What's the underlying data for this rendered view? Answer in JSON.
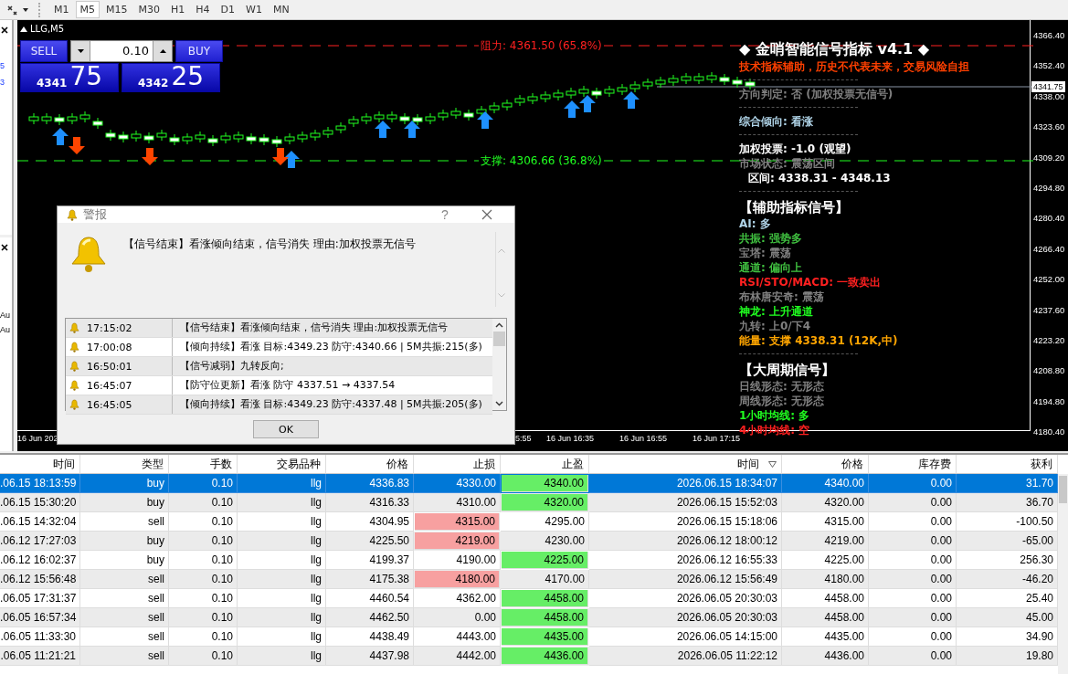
{
  "toolbar": {
    "timeframes": [
      {
        "label": "M1",
        "selected": false
      },
      {
        "label": "M5",
        "selected": true
      },
      {
        "label": "M15",
        "selected": false
      },
      {
        "label": "M30",
        "selected": false
      },
      {
        "label": "H1",
        "selected": false
      },
      {
        "label": "H4",
        "selected": false
      },
      {
        "label": "D1",
        "selected": false
      },
      {
        "label": "W1",
        "selected": false
      },
      {
        "label": "MN",
        "selected": false
      }
    ]
  },
  "left_panel": {
    "top_items": [
      "5",
      "3"
    ],
    "bottom_items": [
      "Au",
      "Au"
    ]
  },
  "chart": {
    "symbol": "LLG,M5",
    "trade_panel": {
      "sell_label": "SELL",
      "buy_label": "BUY",
      "lot": "0.10",
      "sell_price_main": "4341",
      "sell_price_big": "75",
      "buy_price_main": "4342",
      "buy_price_big": "25"
    },
    "resistance_label": "阻力: 4361.50 (65.8%)",
    "support_label": "支撑: 4306.66 (36.8%)",
    "current_price": "4341.75",
    "price_axis": [
      "4366.40",
      "4352.40",
      "4338.00",
      "4323.60",
      "4309.20",
      "4294.80",
      "4280.40",
      "4266.40",
      "4252.00",
      "4237.60",
      "4223.20",
      "4208.80",
      "4194.80",
      "4180.40"
    ],
    "time_axis": [
      "16 Jun 202",
      "5:55",
      "16 Jun 16:35",
      "16 Jun 16:55",
      "16 Jun 17:15"
    ],
    "indicator_lines": [
      {
        "kind": "title",
        "text": "◆ 金哨智能信号指标 v4.1 ◆",
        "color": "#ffffff"
      },
      {
        "kind": "line",
        "text": "技术指标辅助，历史不代表未来，交易风险自担",
        "color": "#ff4000"
      },
      {
        "kind": "separator"
      },
      {
        "kind": "line",
        "text": "方向判定: 否 (加权投票无信号)",
        "color": "#808080"
      },
      {
        "kind": "separator"
      },
      {
        "kind": "line",
        "text": "综合倾向: 看涨",
        "color": "#b0d4e8"
      },
      {
        "kind": "separator"
      },
      {
        "kind": "line",
        "text": "加权投票: -1.0 (观望)",
        "color": "#ffffff"
      },
      {
        "kind": "line",
        "text": "市场状态: 震荡区间",
        "color": "#808080"
      },
      {
        "kind": "indented",
        "text": "区间: 4338.31 - 4348.13",
        "color": "#ffffff"
      },
      {
        "kind": "separator"
      },
      {
        "kind": "section",
        "text": "【辅助指标信号】",
        "color": "#ffffff"
      },
      {
        "kind": "line",
        "text": "AI: 多",
        "color": "#b0d4e8"
      },
      {
        "kind": "line",
        "text": "共振: 强势多",
        "color": "#40c040"
      },
      {
        "kind": "line",
        "text": "宝塔: 震荡",
        "color": "#808080"
      },
      {
        "kind": "line",
        "text": "通道: 偏向上",
        "color": "#40c040"
      },
      {
        "kind": "line",
        "text": "RSI/STO/MACD: 一致卖出",
        "color": "#ff2020"
      },
      {
        "kind": "line",
        "text": "布林唐安奇: 震荡",
        "color": "#808080"
      },
      {
        "kind": "line",
        "text": "神龙: 上升通道",
        "color": "#20ff20"
      },
      {
        "kind": "line",
        "text": "九转: 上0/下4",
        "color": "#808080"
      },
      {
        "kind": "line",
        "text": "能量: 支撑 4338.31 (12K,中)",
        "color": "#ffa500"
      },
      {
        "kind": "separator"
      },
      {
        "kind": "section",
        "text": "【大周期信号】",
        "color": "#ffffff"
      },
      {
        "kind": "line",
        "text": "日线形态: 无形态",
        "color": "#808080"
      },
      {
        "kind": "line",
        "text": "周线形态: 无形态",
        "color": "#808080"
      },
      {
        "kind": "line",
        "text": "1小时均线: 多",
        "color": "#20ff20"
      },
      {
        "kind": "line",
        "text": "4小时均线: 空",
        "color": "#ff2020"
      }
    ]
  },
  "alert_dialog": {
    "title": "警报",
    "help": "?",
    "message": "【信号结束】看涨倾向结束，信号消失 理由:加权投票无信号",
    "rows": [
      {
        "time": "17:15:02",
        "message": "【信号结束】看涨倾向结束，信号消失 理由:加权投票无信号"
      },
      {
        "time": "17:00:08",
        "message": "【倾向持续】看涨 目标:4349.23 防守:4340.66 | 5M共振:215(多)"
      },
      {
        "time": "16:50:01",
        "message": "【信号减弱】九转反向;"
      },
      {
        "time": "16:45:07",
        "message": "【防守位更新】看涨 防守 4337.51 → 4337.54"
      },
      {
        "time": "16:45:05",
        "message": "【倾向持续】看涨 目标:4349.23 防守:4337.48 | 5M共振:205(多)"
      }
    ],
    "ok_label": "OK"
  },
  "table": {
    "columns": [
      {
        "label": "时间",
        "sorted": false
      },
      {
        "label": "类型",
        "sorted": false
      },
      {
        "label": "手数",
        "sorted": false
      },
      {
        "label": "交易品种",
        "sorted": false
      },
      {
        "label": "价格",
        "sorted": false
      },
      {
        "label": "止损",
        "sorted": false
      },
      {
        "label": "止盈",
        "sorted": false
      },
      {
        "label": "时间",
        "sorted": true
      },
      {
        "label": "价格",
        "sorted": false
      },
      {
        "label": "库存费",
        "sorted": false
      },
      {
        "label": "获利",
        "sorted": false
      }
    ],
    "rows": [
      {
        "selected": true,
        "sl_highlight": false,
        "tp_highlight": true,
        "cells": [
          ".06.15 18:13:59",
          "buy",
          "0.10",
          "llg",
          "4336.83",
          "4330.00",
          "4340.00",
          "2026.06.15 18:34:07",
          "4340.00",
          "0.00",
          "31.70"
        ]
      },
      {
        "selected": false,
        "sl_highlight": false,
        "tp_highlight": true,
        "cells": [
          ".06.15 15:30:20",
          "buy",
          "0.10",
          "llg",
          "4316.33",
          "4310.00",
          "4320.00",
          "2026.06.15 15:52:03",
          "4320.00",
          "0.00",
          "36.70"
        ]
      },
      {
        "selected": false,
        "sl_highlight": true,
        "tp_highlight": false,
        "cells": [
          ".06.15 14:32:04",
          "sell",
          "0.10",
          "llg",
          "4304.95",
          "4315.00",
          "4295.00",
          "2026.06.15 15:18:06",
          "4315.00",
          "0.00",
          "-100.50"
        ]
      },
      {
        "selected": false,
        "sl_highlight": true,
        "tp_highlight": false,
        "cells": [
          ".06.12 17:27:03",
          "buy",
          "0.10",
          "llg",
          "4225.50",
          "4219.00",
          "4230.00",
          "2026.06.12 18:00:12",
          "4219.00",
          "0.00",
          "-65.00"
        ]
      },
      {
        "selected": false,
        "sl_highlight": false,
        "tp_highlight": true,
        "cells": [
          ".06.12 16:02:37",
          "buy",
          "0.10",
          "llg",
          "4199.37",
          "4190.00",
          "4225.00",
          "2026.06.12 16:55:33",
          "4225.00",
          "0.00",
          "256.30"
        ]
      },
      {
        "selected": false,
        "sl_highlight": true,
        "tp_highlight": false,
        "cells": [
          ".06.12 15:56:48",
          "sell",
          "0.10",
          "llg",
          "4175.38",
          "4180.00",
          "4170.00",
          "2026.06.12 15:56:49",
          "4180.00",
          "0.00",
          "-46.20"
        ]
      },
      {
        "selected": false,
        "sl_highlight": false,
        "tp_highlight": true,
        "cells": [
          ".06.05 17:31:37",
          "sell",
          "0.10",
          "llg",
          "4460.54",
          "4362.00",
          "4458.00",
          "2026.06.05 20:30:03",
          "4458.00",
          "0.00",
          "25.40"
        ]
      },
      {
        "selected": false,
        "sl_highlight": false,
        "tp_highlight": true,
        "cells": [
          ".06.05 16:57:34",
          "sell",
          "0.10",
          "llg",
          "4462.50",
          "0.00",
          "4458.00",
          "2026.06.05 20:30:03",
          "4458.00",
          "0.00",
          "45.00"
        ]
      },
      {
        "selected": false,
        "sl_highlight": false,
        "tp_highlight": true,
        "cells": [
          ".06.05 11:33:30",
          "sell",
          "0.10",
          "llg",
          "4438.49",
          "4443.00",
          "4435.00",
          "2026.06.05 14:15:00",
          "4435.00",
          "0.00",
          "34.90"
        ]
      },
      {
        "selected": false,
        "sl_highlight": false,
        "tp_highlight": true,
        "cells": [
          ".06.05 11:21:21",
          "sell",
          "0.10",
          "llg",
          "4437.98",
          "4442.00",
          "4436.00",
          "2026.06.05 11:22:12",
          "4436.00",
          "0.00",
          "19.80"
        ]
      }
    ]
  }
}
